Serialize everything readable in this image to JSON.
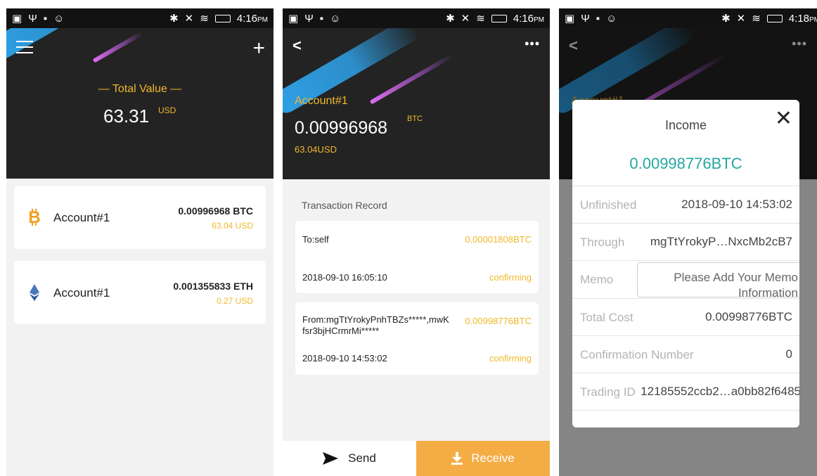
{
  "colors": {
    "accent_gold": "#f0b92c",
    "income_teal": "#23a8a0",
    "receive_orange": "#f4ac45",
    "header_dark": "#232323"
  },
  "screens": [
    {
      "status": {
        "time": "4:16",
        "ampm": "PM"
      },
      "header": {
        "menu_icon": "hamburger-menu-icon",
        "add_icon": "plus-icon"
      },
      "total": {
        "label": "— Total Value —",
        "value": "63.31",
        "unit": "USD"
      },
      "accounts": [
        {
          "icon": "bitcoin-icon",
          "name": "Account#1",
          "balance": "0.00996968 BTC",
          "usd": "63.04 USD"
        },
        {
          "icon": "ethereum-icon",
          "name": "Account#1",
          "balance": "0.001355833 ETH",
          "usd": "0.27 USD"
        }
      ]
    },
    {
      "status": {
        "time": "4:16",
        "ampm": "PM"
      },
      "header": {
        "back_icon": "back-arrow-icon",
        "more_icon": "more-icon"
      },
      "account": {
        "name": "Account#1",
        "balance": "0.00996968",
        "unit": "BTC",
        "usd": "63.04USD"
      },
      "record_title": "Transaction Record",
      "transactions": [
        {
          "party": "To:self",
          "amount": "0.00001808BTC",
          "time": "2018-09-10 16:05:10",
          "status": "confirming"
        },
        {
          "party": "From:mgTtYrokyPnhTBZs*****,mwKfsr3bjHCrmrMi*****",
          "amount": "0.00998776BTC",
          "time": "2018-09-10 14:53:02",
          "status": "confirming"
        }
      ],
      "tabs": {
        "send": "Send",
        "receive": "Receive"
      }
    },
    {
      "status": {
        "time": "4:18",
        "ampm": "PM"
      },
      "background": {
        "account_name": "Account#1"
      },
      "modal": {
        "title": "Income",
        "amount": "0.00998776BTC",
        "rows": [
          {
            "key": "Unfinished",
            "value": "2018-09-10 14:53:02"
          },
          {
            "key": "Through",
            "value": "mgTtYrokyP…NxcMb2cB7"
          },
          {
            "key": "Memo",
            "placeholder": "Please Add Your Memo Information"
          },
          {
            "key": "Total Cost",
            "value": "0.00998776BTC"
          },
          {
            "key": "Confirmation Number",
            "value": "0"
          },
          {
            "key": "Trading ID",
            "value": "12185552ccb2…a0bb82f6485"
          }
        ]
      }
    }
  ]
}
